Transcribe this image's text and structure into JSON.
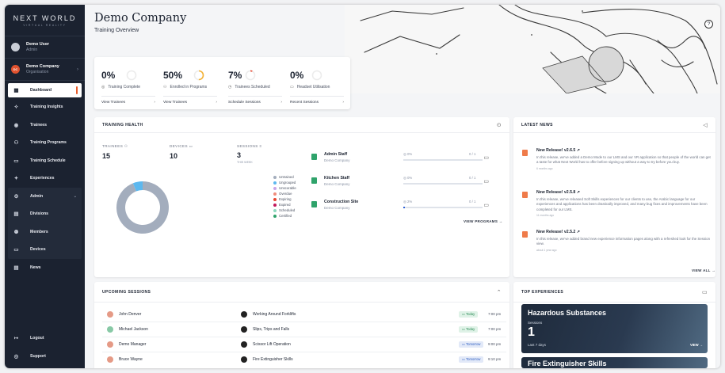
{
  "brand": {
    "name": "NEXT WORLD",
    "tag": "VIRTUAL REALITY"
  },
  "user": {
    "name": "Demo User",
    "role": "Admin",
    "initials": ""
  },
  "org": {
    "name": "Demo Company",
    "type": "Organisation",
    "initials": "DC"
  },
  "nav": [
    {
      "label": "Dashboard",
      "icon": "grid-icon",
      "glyph": "▦"
    },
    {
      "label": "Training Insights",
      "icon": "lightbulb-icon",
      "glyph": "✧"
    },
    {
      "label": "Trainees",
      "icon": "user-icon",
      "glyph": "◉"
    },
    {
      "label": "Training Programs",
      "icon": "users-icon",
      "glyph": "⚇"
    },
    {
      "label": "Training Schedule",
      "icon": "calendar-icon",
      "glyph": "▭"
    },
    {
      "label": "Experiences",
      "icon": "sparkle-icon",
      "glyph": "✦"
    }
  ],
  "admin": {
    "label": "Admin",
    "items": [
      {
        "label": "Divisions",
        "icon": "building-icon",
        "glyph": "▤"
      },
      {
        "label": "Members",
        "icon": "members-icon",
        "glyph": "⚉"
      },
      {
        "label": "Devices",
        "icon": "device-icon",
        "glyph": "▭"
      }
    ]
  },
  "news_nav": {
    "label": "News",
    "glyph": "▤"
  },
  "bottom_nav": [
    {
      "label": "Logout",
      "glyph": "↦"
    },
    {
      "label": "Support",
      "glyph": "◎"
    }
  ],
  "header": {
    "title": "Demo Company",
    "subtitle": "Training Overview",
    "help": "?"
  },
  "stats": [
    {
      "value": "0%",
      "label": "Training Complete",
      "icon": "check-circle-icon",
      "glyph": "◎",
      "link": "View Trainees",
      "progress": 0
    },
    {
      "value": "50%",
      "label": "Enrolled in Programs",
      "icon": "users-icon",
      "glyph": "⚇",
      "link": "View Trainees",
      "progress": 0.5
    },
    {
      "value": "7%",
      "label": "Trainees Scheduled",
      "icon": "clock-icon",
      "glyph": "◷",
      "link": "Schedule Sessions",
      "progress": 0.07
    },
    {
      "value": "0%",
      "label": "Headset Utilisation",
      "icon": "calendar-icon",
      "glyph": "▭",
      "link": "Recent Sessions",
      "progress": 0
    }
  ],
  "training_health": {
    "title": "TRAINING HEALTH",
    "kpis": [
      {
        "label": "TRAINEES",
        "value": "15",
        "sub": ""
      },
      {
        "label": "DEVICES",
        "value": "10",
        "sub": ""
      },
      {
        "label": "SESSIONS",
        "value": "3",
        "sub": "THIS WEEK"
      }
    ],
    "legend": [
      {
        "label": "Untrained",
        "color": "#a3adbd"
      },
      {
        "label": "Ungrouped",
        "color": "#5cb8ef"
      },
      {
        "label": "Unscorable",
        "color": "#c8a6e8"
      },
      {
        "label": "Overdue",
        "color": "#f08c7b"
      },
      {
        "label": "Expiring",
        "color": "#e8462f"
      },
      {
        "label": "Expired",
        "color": "#c2185b"
      },
      {
        "label": "Scheduled",
        "color": "#8fd9c0"
      },
      {
        "label": "Certified",
        "color": "#2fa36b"
      }
    ],
    "donut": [
      0.94,
      0.06
    ],
    "programs": [
      {
        "name": "Admin Staff",
        "company": "Demo Company",
        "pct": "0%",
        "frac": "0 / 1",
        "progress": 0
      },
      {
        "name": "Kitchen Staff",
        "company": "Demo Company",
        "pct": "0%",
        "frac": "0 / 1",
        "progress": 0
      },
      {
        "name": "Construction Site",
        "company": "Demo Company",
        "pct": "2%",
        "frac": "0 / 1",
        "progress": 0.02
      }
    ],
    "view_programs": "VIEW PROGRAMS"
  },
  "latest_news": {
    "title": "LATEST NEWS",
    "items": [
      {
        "title": "New Release! v2.6.5",
        "body": "In this release, we've added a Demo Mode to our LMS and our VR application so that people of the world can get a taste for what Next World has to offer before signing up without a way to try before you buy.",
        "date": "6 months ago"
      },
      {
        "title": "New Release! v2.5.8",
        "body": "In this release, we've released Soft Skills experiences for our clients to use, the Arabic language for our experiences and applications has been drastically improved, and many bug fixes and improvements have been completed for our LMS.",
        "date": "11 months ago"
      },
      {
        "title": "New Release! v2.5.2",
        "body": "In this release, we've added brand new experience information pages along with a refreshed look for the Session view.",
        "date": "about 1 year ago"
      }
    ],
    "view_all": "VIEW ALL"
  },
  "upcoming_sessions": {
    "title": "UPCOMING SESSIONS",
    "rows": [
      {
        "trainee": "John Denver",
        "experience": "Working Around Forklifts",
        "when": "Today",
        "time": "7:00 pm",
        "tag": "green"
      },
      {
        "trainee": "Michael Jackson",
        "experience": "Slips, Trips and Falls",
        "when": "Today",
        "time": "7:00 pm",
        "tag": "green"
      },
      {
        "trainee": "Demo Manager",
        "experience": "Scissor Lift Operation",
        "when": "Tomorrow",
        "time": "9:00 pm",
        "tag": "blue"
      },
      {
        "trainee": "Bruce Wayne",
        "experience": "Fire Extinguisher Skills",
        "when": "Tomorrow",
        "time": "9:10 pm",
        "tag": "blue"
      }
    ]
  },
  "top_experiences": {
    "title": "TOP EXPERIENCES",
    "cards": [
      {
        "title": "Hazardous Substances",
        "sessions_label": "Sessions",
        "sessions": "1",
        "period": "Last 7 days",
        "view": "VIEW"
      },
      {
        "title": "Fire Extinguisher Skills"
      }
    ]
  }
}
